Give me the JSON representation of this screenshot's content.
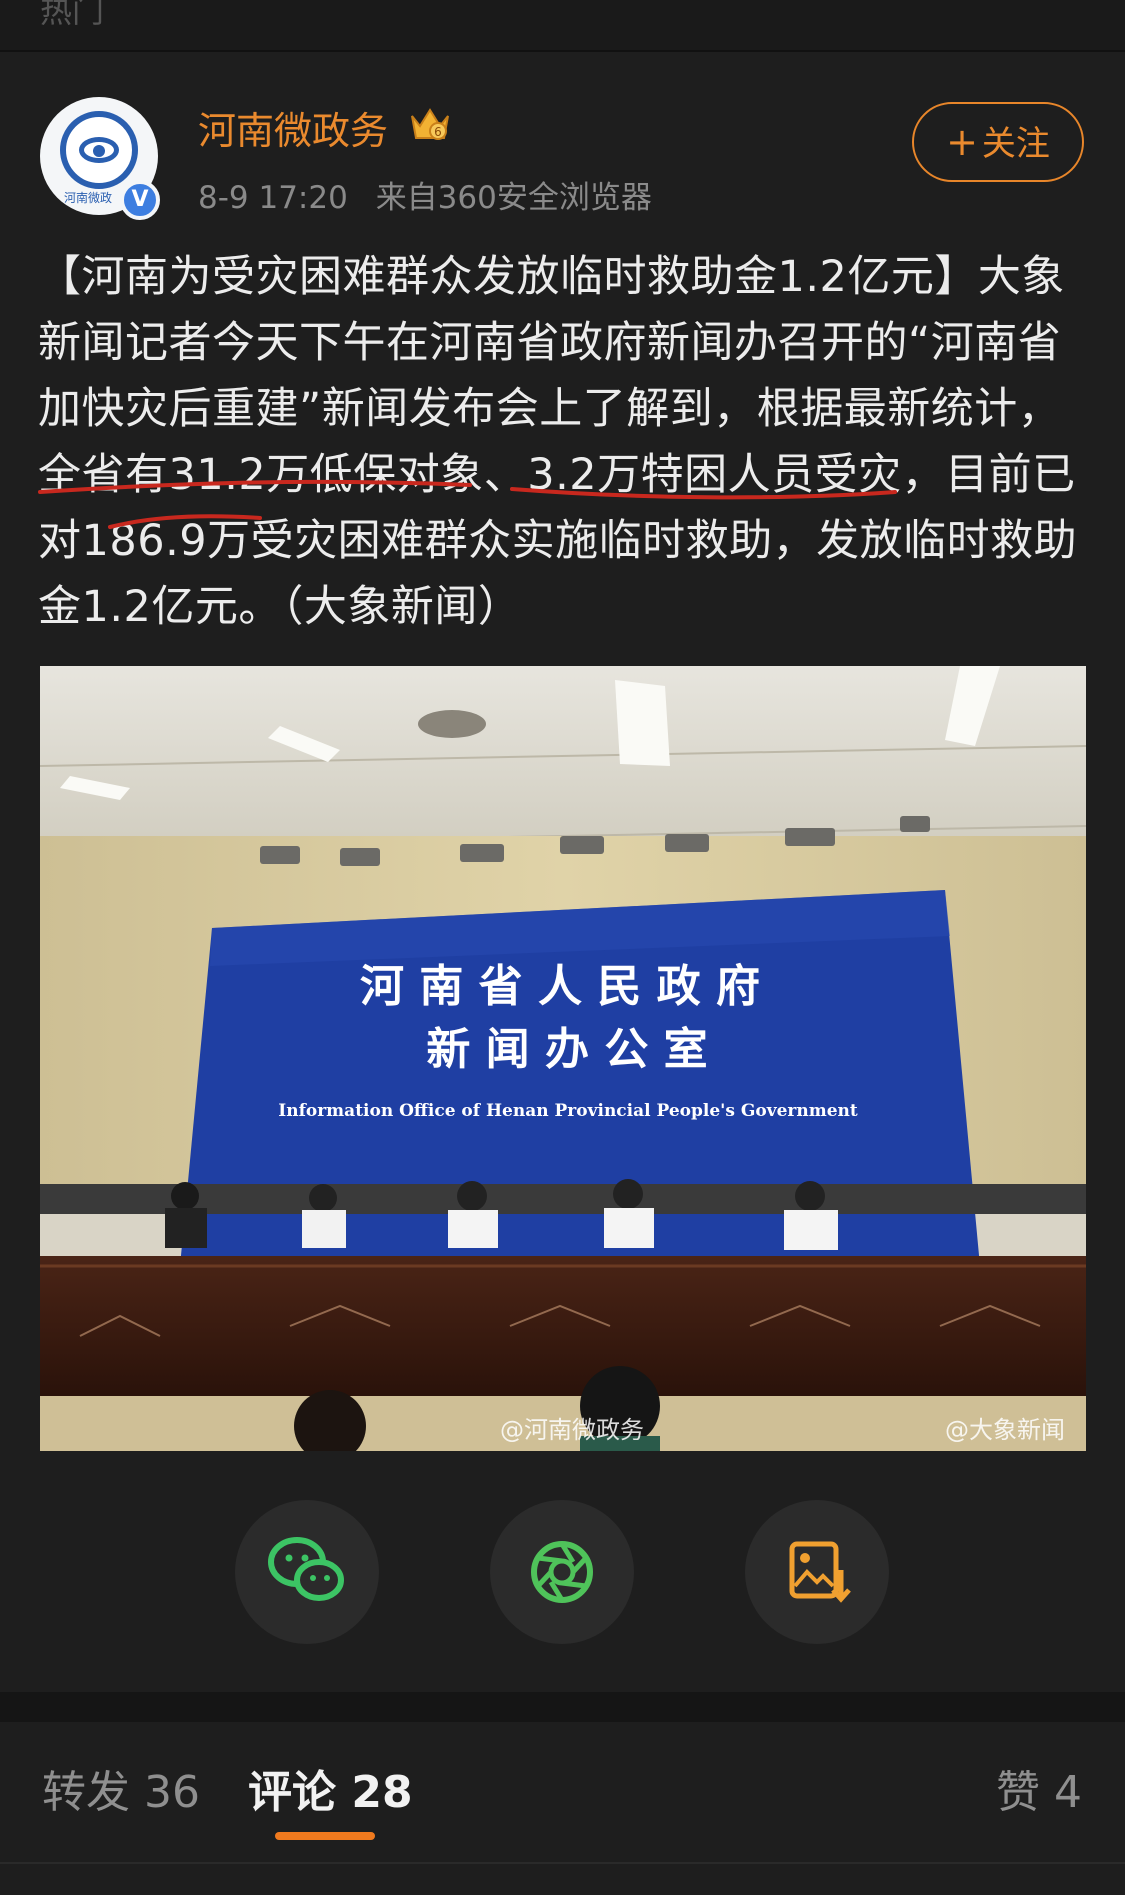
{
  "top_strip": {
    "label": "热门"
  },
  "post": {
    "author": {
      "name": "河南微政务",
      "avatar_text": "河南微政",
      "verified_mark": "V"
    },
    "meta": {
      "time": "8-9 17:20",
      "source": "来自360安全浏览器"
    },
    "follow_button": {
      "plus": "+",
      "label": "关注"
    },
    "text": "【河南为受灾困难群众发放临时救助金1.2亿元】大象新闻记者今天下午在河南省政府新闻办召开的“河南省加快灾后重建”新闻发布会上了解到，根据最新统计，全省有31.2万低保对象、3.2万特困人员受灾，目前已对186.9万受灾困难群众实施临时救助，发放临时救助金1.2亿元。（大象新闻）",
    "image": {
      "backdrop_line1": "河 南 省 人 民 政 府",
      "backdrop_line2": "新 闻 办 公 室",
      "backdrop_line3": "Information Office of Henan Provincial People's Government",
      "watermark_left": "@河南微政务",
      "watermark_right": "@大象新闻"
    },
    "share_buttons": [
      "wechat-icon",
      "moments-icon",
      "save-image-icon"
    ]
  },
  "tabs": {
    "repost": {
      "label": "转发",
      "count": "36"
    },
    "comment": {
      "label": "评论",
      "count": "28"
    },
    "like": {
      "label": "赞",
      "count": "4"
    }
  },
  "colors": {
    "accent": "#ea8a2e",
    "background": "#1e1e1e",
    "indicator": "#f07a1e",
    "backdrop_blue": "#1f3fa3",
    "wechat_green": "#3cc464"
  }
}
